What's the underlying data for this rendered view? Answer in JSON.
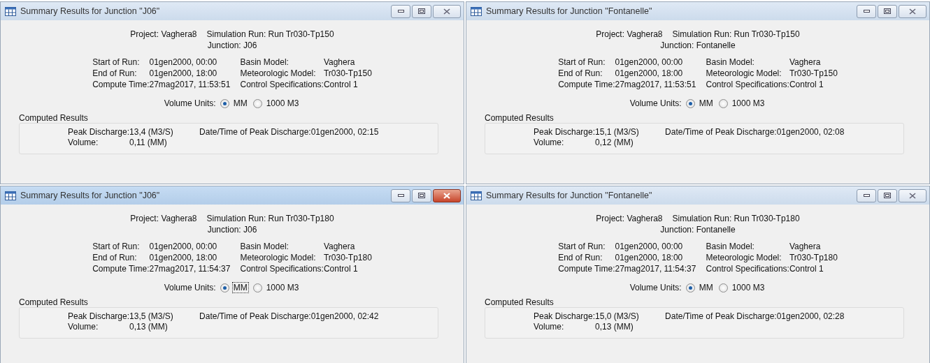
{
  "windows": [
    {
      "title": "Summary Results for Junction \"J06\"",
      "active": false,
      "header": [
        "Project: Vaghera8",
        "Simulation Run: Run Tr030-Tp150"
      ],
      "junction": "Junction: J06",
      "info": [
        [
          {
            "label": "Start of Run:",
            "value": "01gen2000, 00:00"
          },
          {
            "label": "Basin Model:",
            "value": "Vaghera"
          }
        ],
        [
          {
            "label": "End of Run:",
            "value": "01gen2000, 18:00"
          },
          {
            "label": "Meteorologic Model:",
            "value": "Tr030-Tp150"
          }
        ],
        [
          {
            "label": "Compute Time:",
            "value": "27mag2017, 11:53:51"
          },
          {
            "label": "Control Specifications:",
            "value": "Control 1"
          }
        ]
      ],
      "volume_units": {
        "label": "Volume Units:",
        "options": [
          {
            "label": "MM",
            "selected": true,
            "focused": false
          },
          {
            "label": "1000 M3",
            "selected": false,
            "focused": false
          }
        ]
      },
      "computed_results": {
        "title": "Computed Results",
        "rows": [
          [
            {
              "label": "Peak Discharge:",
              "value": "13,4 (M3/S)"
            },
            {
              "label": "Date/Time of Peak Discharge:",
              "value": "01gen2000, 02:15"
            }
          ],
          [
            {
              "label": "Volume:",
              "value": "0,11 (MM)"
            }
          ]
        ]
      }
    },
    {
      "title": "Summary Results for Junction \"Fontanelle\"",
      "active": false,
      "header": [
        "Project: Vaghera8",
        "Simulation Run: Run Tr030-Tp150"
      ],
      "junction": "Junction: Fontanelle",
      "info": [
        [
          {
            "label": "Start of Run:",
            "value": "01gen2000, 00:00"
          },
          {
            "label": "Basin Model:",
            "value": "Vaghera"
          }
        ],
        [
          {
            "label": "End of Run:",
            "value": "01gen2000, 18:00"
          },
          {
            "label": "Meteorologic Model:",
            "value": "Tr030-Tp150"
          }
        ],
        [
          {
            "label": "Compute Time:",
            "value": "27mag2017, 11:53:51"
          },
          {
            "label": "Control Specifications:",
            "value": "Control 1"
          }
        ]
      ],
      "volume_units": {
        "label": "Volume Units:",
        "options": [
          {
            "label": "MM",
            "selected": true,
            "focused": false
          },
          {
            "label": "1000 M3",
            "selected": false,
            "focused": false
          }
        ]
      },
      "computed_results": {
        "title": "Computed Results",
        "rows": [
          [
            {
              "label": "Peak Discharge:",
              "value": "15,1 (M3/S)"
            },
            {
              "label": "Date/Time of Peak Discharge:",
              "value": "01gen2000, 02:08"
            }
          ],
          [
            {
              "label": "Volume:",
              "value": "0,12 (MM)"
            }
          ]
        ]
      }
    },
    {
      "title": "Summary Results for Junction \"J06\"",
      "active": true,
      "header": [
        "Project: Vaghera8",
        "Simulation Run: Run Tr030-Tp180"
      ],
      "junction": "Junction: J06",
      "info": [
        [
          {
            "label": "Start of Run:",
            "value": "01gen2000, 00:00"
          },
          {
            "label": "Basin Model:",
            "value": "Vaghera"
          }
        ],
        [
          {
            "label": "End of Run:",
            "value": "01gen2000, 18:00"
          },
          {
            "label": "Meteorologic Model:",
            "value": "Tr030-Tp180"
          }
        ],
        [
          {
            "label": "Compute Time:",
            "value": "27mag2017, 11:54:37"
          },
          {
            "label": "Control Specifications:",
            "value": "Control 1"
          }
        ]
      ],
      "volume_units": {
        "label": "Volume Units:",
        "options": [
          {
            "label": "MM",
            "selected": true,
            "focused": true
          },
          {
            "label": "1000 M3",
            "selected": false,
            "focused": false
          }
        ]
      },
      "computed_results": {
        "title": "Computed Results",
        "rows": [
          [
            {
              "label": "Peak Discharge:",
              "value": "13,5 (M3/S)"
            },
            {
              "label": "Date/Time of Peak Discharge:",
              "value": "01gen2000, 02:42"
            }
          ],
          [
            {
              "label": "Volume:",
              "value": "0,13 (MM)"
            }
          ]
        ]
      }
    },
    {
      "title": "Summary Results for Junction \"Fontanelle\"",
      "active": false,
      "header": [
        "Project: Vaghera8",
        "Simulation Run: Run Tr030-Tp180"
      ],
      "junction": "Junction: Fontanelle",
      "info": [
        [
          {
            "label": "Start of Run:",
            "value": "01gen2000, 00:00"
          },
          {
            "label": "Basin Model:",
            "value": "Vaghera"
          }
        ],
        [
          {
            "label": "End of Run:",
            "value": "01gen2000, 18:00"
          },
          {
            "label": "Meteorologic Model:",
            "value": "Tr030-Tp180"
          }
        ],
        [
          {
            "label": "Compute Time:",
            "value": "27mag2017, 11:54:37"
          },
          {
            "label": "Control Specifications:",
            "value": "Control 1"
          }
        ]
      ],
      "volume_units": {
        "label": "Volume Units:",
        "options": [
          {
            "label": "MM",
            "selected": true,
            "focused": false
          },
          {
            "label": "1000 M3",
            "selected": false,
            "focused": false
          }
        ]
      },
      "computed_results": {
        "title": "Computed Results",
        "rows": [
          [
            {
              "label": "Peak Discharge:",
              "value": "15,0 (M3/S)"
            },
            {
              "label": "Date/Time of Peak Discharge:",
              "value": "01gen2000, 02:28"
            }
          ],
          [
            {
              "label": "Volume:",
              "value": "0,13 (MM)"
            }
          ]
        ]
      }
    }
  ]
}
